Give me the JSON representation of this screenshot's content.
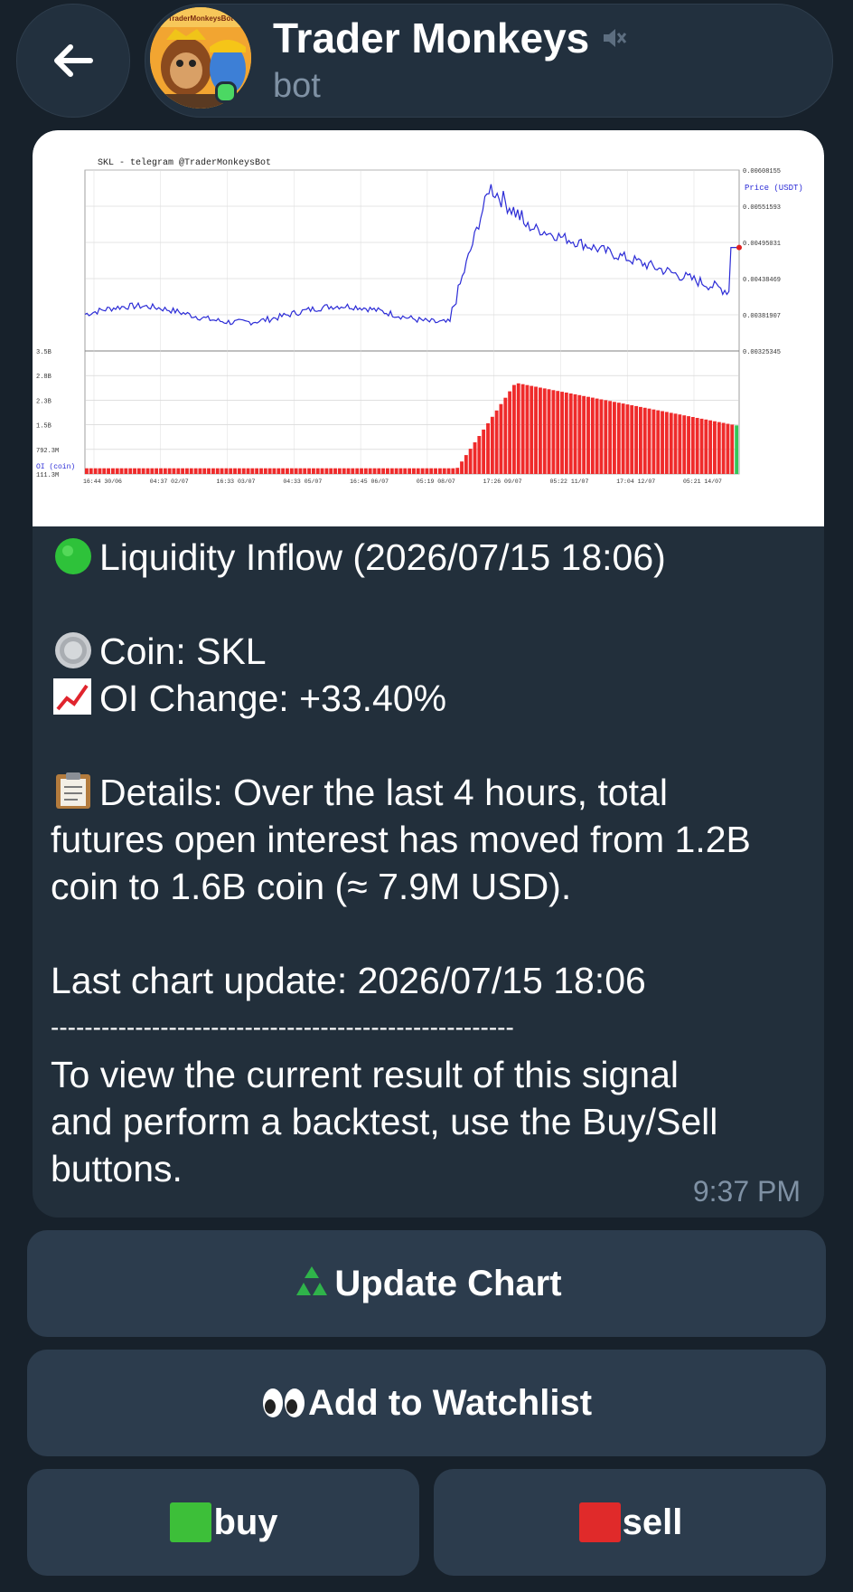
{
  "header": {
    "title": "Trader Monkeys",
    "subtitle": "bot",
    "avatar_caption": "TraderMonkeysBot",
    "back_icon": "arrow-left-icon",
    "muted_icon": "muted-speaker-icon"
  },
  "chart": {
    "title": "SKL - telegram @TraderMonkeysBot",
    "price_label": "Price (USDT)",
    "oi_label": "OI (coin)",
    "price_ticks": [
      "0.00608155",
      "0.00551593",
      "0.00495031",
      "0.00438469",
      "0.00381907",
      "0.00325345"
    ],
    "oi_ticks": [
      "3.5B",
      "2.8B",
      "2.3B",
      "1.5B",
      "792.3M",
      "111.3M"
    ],
    "x_ticks": [
      "16:44 30/06",
      "04:37 02/07",
      "16:33 03/07",
      "04:33 05/07",
      "16:45 06/07",
      "05:19 08/07",
      "17:26 09/07",
      "05:22 11/07",
      "17:04 12/07",
      "05:21 14/07"
    ]
  },
  "message": {
    "headline": "Liquidity Inflow (2026/07/15 18:06)",
    "coin": "Coin: SKL",
    "oi_change": "OI Change: +33.40%",
    "details_line1": "Details: Over the last 4 hours, total",
    "details_line2": "futures open interest has moved from 1.2B",
    "details_line3": "coin to 1.6B coin (≈ 7.9M USD).",
    "last_update": "Last chart update: 2026/07/15 18:06",
    "separator": "-------------------------------------------------------",
    "footer_line1": "To view the current result of this signal",
    "footer_line2": "and perform a backtest, use the Buy/Sell",
    "footer_line3": "buttons.",
    "time": "9:37 PM"
  },
  "buttons": {
    "update_chart": "Update Chart",
    "add_watchlist": "Add to Watchlist",
    "buy": "buy",
    "sell": "sell"
  },
  "colors": {
    "background": "#17212b",
    "bubble": "#222f3b",
    "button": "#2c3c4d",
    "price_line": "#2b2bd6",
    "oi_bar": "#ef2b2b"
  }
}
